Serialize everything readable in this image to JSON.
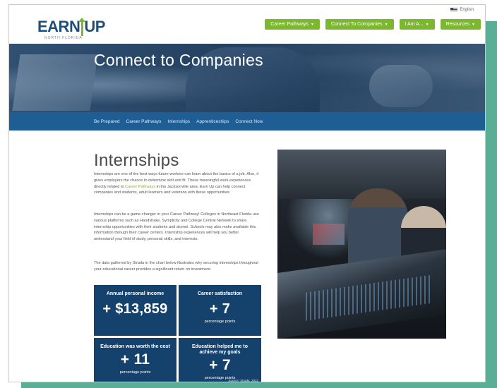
{
  "language": {
    "label": "English"
  },
  "logo": {
    "brand_earn": "EARN",
    "brand_up": "UP",
    "tagline": "NORTH FLORIDA"
  },
  "nav": [
    {
      "label": "Career Pathways"
    },
    {
      "label": "Connect To Companies"
    },
    {
      "label": "I Am A..."
    },
    {
      "label": "Resources"
    }
  ],
  "hero": {
    "title": "Connect to Companies"
  },
  "subnav": [
    {
      "label": "Be Prepared"
    },
    {
      "label": "Career Pathways"
    },
    {
      "label": "Internships"
    },
    {
      "label": "Apprenticeships"
    },
    {
      "label": "Connect Now"
    }
  ],
  "content": {
    "heading": "Internships",
    "p1_a": "Internships are one of the best ways future workers can learn about the basics of a job. Also, it gives employers the chance to determine skill and fit. These meaningful work experiences directly related to ",
    "p1_link": "Career Pathways",
    "p1_b": " in the Jacksonville area. Earn Up can help connect companies and students, adult learners and veterans with these opportunities.",
    "p2": "Internships can be a game-changer in your Career Pathway! Colleges in Northeast Florida use various platforms such as Handshake, Symplicity and College Central Network to share internship opportunities with their students and alumni. Schools may also make available this information through their career centers. Internship experiences will help you better understand your field of study, personal skills, and interests.",
    "p3": "The data gathered by Strada in the chart below illustrates why securing internships throughout your educational career provides a significant return on investment."
  },
  "stats": [
    {
      "label": "Annual personal income",
      "value": "+ $13,859",
      "unit": ""
    },
    {
      "label": "Career satisfaction",
      "value": "+ 7",
      "unit": "percentage points"
    },
    {
      "label": "Education was worth the cost",
      "value": "+ 11",
      "unit": "percentage points"
    },
    {
      "label": "Education helped me to achieve my goals",
      "value": "+ 7",
      "unit": "percentage points"
    }
  ],
  "stats_source": "Source: Strada, 2022",
  "colors": {
    "accent_green": "#7cb82f",
    "navy": "#15426d",
    "subnav_blue": "#1f5e95",
    "frame_teal": "#5aae95"
  }
}
